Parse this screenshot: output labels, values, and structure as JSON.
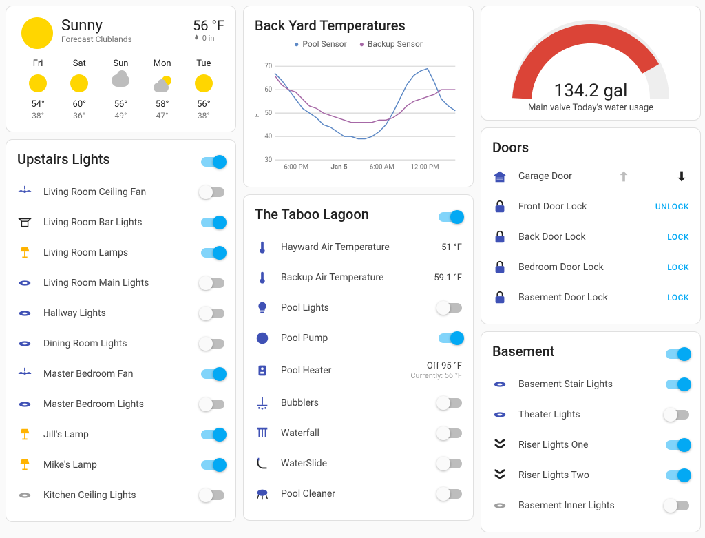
{
  "weather": {
    "condition": "Sunny",
    "location": "Forecast Clublands",
    "temp": "56 °F",
    "precip": "0 in",
    "days": [
      {
        "name": "Fri",
        "icon": "sun",
        "hi": "54°",
        "lo": "38°"
      },
      {
        "name": "Sat",
        "icon": "sun",
        "hi": "60°",
        "lo": "36°"
      },
      {
        "name": "Sun",
        "icon": "cloud",
        "hi": "56°",
        "lo": "49°"
      },
      {
        "name": "Mon",
        "icon": "partly",
        "hi": "58°",
        "lo": "47°"
      },
      {
        "name": "Tue",
        "icon": "sun",
        "hi": "56°",
        "lo": "38°"
      }
    ]
  },
  "upstairs": {
    "title": "Upstairs Lights",
    "master_on": true,
    "items": [
      {
        "icon": "fan",
        "label": "Living Room Ceiling Fan",
        "on": false,
        "color": "blue"
      },
      {
        "icon": "bar",
        "label": "Living Room Bar Lights",
        "on": true,
        "color": "grey"
      },
      {
        "icon": "lamp",
        "label": "Living Room Lamps",
        "on": true,
        "color": "amber"
      },
      {
        "icon": "light",
        "label": "Living Room Main Lights",
        "on": false,
        "color": "blue"
      },
      {
        "icon": "light",
        "label": "Hallway Lights",
        "on": false,
        "color": "blue"
      },
      {
        "icon": "light",
        "label": "Dining Room Lights",
        "on": false,
        "color": "blue"
      },
      {
        "icon": "fan",
        "label": "Master Bedroom Fan",
        "on": true,
        "color": "blue"
      },
      {
        "icon": "light",
        "label": "Master Bedroom Lights",
        "on": false,
        "color": "blue"
      },
      {
        "icon": "lamp",
        "label": "Jill's Lamp",
        "on": true,
        "color": "amber"
      },
      {
        "icon": "lamp",
        "label": "Mike's Lamp",
        "on": true,
        "color": "amber"
      },
      {
        "icon": "light",
        "label": "Kitchen Ceiling Lights",
        "on": false,
        "color": "grey",
        "faded": true
      }
    ]
  },
  "chart": {
    "title": "Back Yard Temperatures",
    "series_a_name": "Pool Sensor",
    "series_b_name": "Backup Sensor",
    "ylabel": "°F"
  },
  "chart_data": {
    "type": "line",
    "title": "Back Yard Temperatures",
    "ylabel": "°F",
    "ylim": [
      30,
      70
    ],
    "x_ticks": [
      "6:00 PM",
      "Jan 5",
      "6:00 AM",
      "12:00 PM"
    ],
    "series": [
      {
        "name": "Pool Sensor",
        "color": "#5c88c5",
        "values": [
          67,
          64,
          60,
          56,
          52,
          50,
          48,
          45,
          44,
          42,
          40,
          40,
          39,
          39,
          40,
          42,
          45,
          50,
          56,
          62,
          66,
          68,
          69,
          63,
          56,
          53,
          51
        ]
      },
      {
        "name": "Backup Sensor",
        "color": "#a668a6",
        "values": [
          66,
          62,
          60,
          59,
          56,
          53,
          52,
          50,
          49,
          48,
          47,
          46,
          46,
          46,
          46,
          47,
          47,
          48,
          50,
          53,
          55,
          56,
          57,
          58,
          60,
          60,
          60
        ]
      }
    ]
  },
  "lagoon": {
    "title": "The Taboo Lagoon",
    "master_on": true,
    "items": [
      {
        "icon": "therm",
        "label": "Hayward Air Temperature",
        "value": "51 °F"
      },
      {
        "icon": "therm",
        "label": "Backup Air Temperature",
        "value": "59.1 °F"
      },
      {
        "icon": "bulb",
        "label": "Pool Lights",
        "on": false
      },
      {
        "icon": "pump",
        "label": "Pool Pump",
        "on": true
      },
      {
        "icon": "heater",
        "label": "Pool Heater",
        "value": "Off 95 °F",
        "sub": "Currently: 56 °F"
      },
      {
        "icon": "bubbles",
        "label": "Bubblers",
        "on": false
      },
      {
        "icon": "waterfall",
        "label": "Waterfall",
        "on": false
      },
      {
        "icon": "slide",
        "label": "WaterSlide",
        "on": false
      },
      {
        "icon": "cleaner",
        "label": "Pool Cleaner",
        "on": false
      }
    ]
  },
  "gauge": {
    "value": "134.2 gal",
    "label": "Main valve Today's water usage"
  },
  "doors": {
    "title": "Doors",
    "garage": {
      "label": "Garage Door"
    },
    "locks": [
      {
        "label": "Front Door Lock",
        "action": "UNLOCK"
      },
      {
        "label": "Back Door Lock",
        "action": "LOCK"
      },
      {
        "label": "Bedroom Door Lock",
        "action": "LOCK"
      },
      {
        "label": "Basement Door Lock",
        "action": "LOCK"
      }
    ]
  },
  "basement": {
    "title": "Basement",
    "master_on": true,
    "items": [
      {
        "icon": "light",
        "label": "Basement Stair Lights",
        "on": true,
        "color": "blue"
      },
      {
        "icon": "light",
        "label": "Theater Lights",
        "on": false,
        "color": "blue"
      },
      {
        "icon": "riser",
        "label": "Riser Lights One",
        "on": true,
        "color": "blue"
      },
      {
        "icon": "riser",
        "label": "Riser Lights Two",
        "on": true,
        "color": "blue"
      },
      {
        "icon": "light",
        "label": "Basement Inner Lights",
        "on": false,
        "color": "grey",
        "faded": true
      }
    ]
  }
}
